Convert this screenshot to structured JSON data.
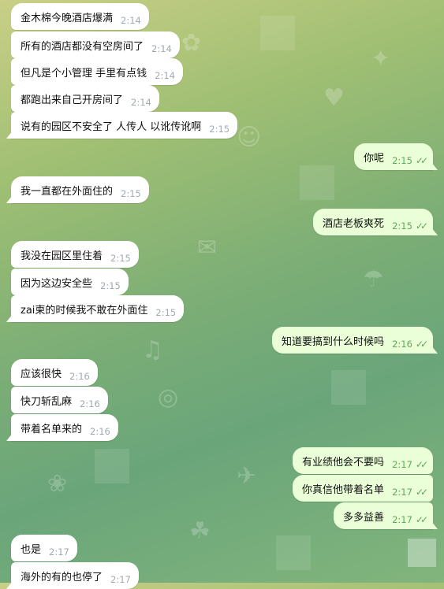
{
  "theme": {
    "incoming_bg": "#ffffff",
    "outgoing_bg": "#eaffd8",
    "time_in": "#a1aab3",
    "time_out": "#5fa858"
  },
  "messages": [
    {
      "dir": "in",
      "text": "金木棉今晚酒店爆满",
      "time": "2:14"
    },
    {
      "dir": "in",
      "text": "所有的酒店都没有空房间了",
      "time": "2:14"
    },
    {
      "dir": "in",
      "text": "但凡是个小管理 手里有点钱",
      "time": "2:14"
    },
    {
      "dir": "in",
      "text": "都跑出来自己开房间了",
      "time": "2:14"
    },
    {
      "dir": "in",
      "text": "说有的园区不安全了 人传人 以讹传讹啊",
      "time": "2:15"
    },
    {
      "dir": "out",
      "text": "你呢",
      "time": "2:15"
    },
    {
      "dir": "in",
      "text": "我一直都在外面住的",
      "time": "2:15"
    },
    {
      "dir": "out",
      "text": "酒店老板爽死",
      "time": "2:15"
    },
    {
      "dir": "in",
      "text": "我没在园区里住着",
      "time": "2:15"
    },
    {
      "dir": "in",
      "text": "因为这边安全些",
      "time": "2:15"
    },
    {
      "dir": "in",
      "text": "zai柬的时候我不敢在外面住",
      "time": "2:15"
    },
    {
      "dir": "out",
      "text": "知道要搞到什么时候吗",
      "time": "2:16"
    },
    {
      "dir": "in",
      "text": "应该很快",
      "time": "2:16"
    },
    {
      "dir": "in",
      "text": "快刀斩乱麻",
      "time": "2:16"
    },
    {
      "dir": "in",
      "text": "带着名单来的",
      "time": "2:16"
    },
    {
      "dir": "out",
      "text": "有业绩他会不要吗",
      "time": "2:17"
    },
    {
      "dir": "out",
      "text": "你真信他带着名单",
      "time": "2:17"
    },
    {
      "dir": "out",
      "text": "多多益善",
      "time": "2:17"
    },
    {
      "dir": "in",
      "text": "也是",
      "time": "2:17"
    },
    {
      "dir": "in",
      "text": "海外的有的也停了",
      "time": "2:17"
    }
  ],
  "read_ticks": "✓✓"
}
